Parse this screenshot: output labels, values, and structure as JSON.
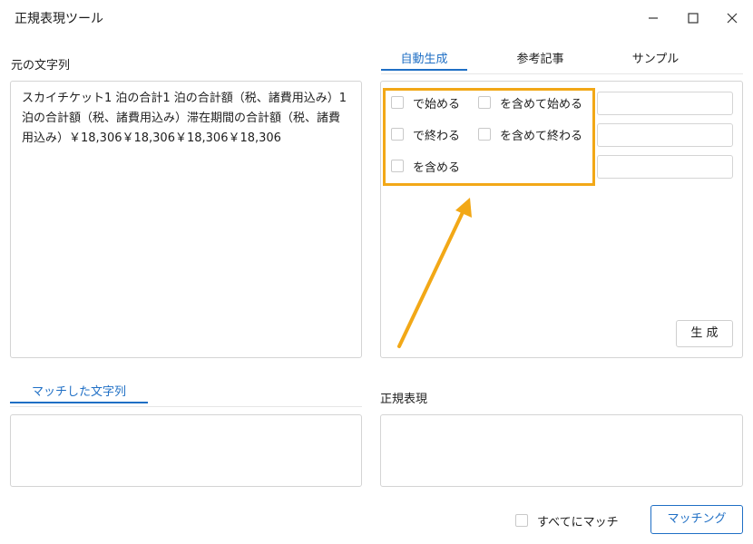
{
  "window": {
    "title": "正規表現ツール"
  },
  "source": {
    "label": "元の文字列",
    "text": "スカイチケット1 泊の合計1 泊の合計額（税、諸費用込み）1 泊の合計額（税、諸費用込み）滞在期間の合計額（税、諸費用込み）￥18,306￥18,306￥18,306￥18,306"
  },
  "tabs": [
    {
      "label": "自動生成"
    },
    {
      "label": "参考記事"
    },
    {
      "label": "サンプル"
    }
  ],
  "options": {
    "starts_with": "で始める",
    "contains_starts": "を含めて始める",
    "ends_with": "で終わる",
    "contains_ends": "を含めて終わる",
    "contains": "を含める"
  },
  "generate_button": "生 成",
  "matched": {
    "tab_label": "マッチした文字列"
  },
  "regex": {
    "label": "正規表現"
  },
  "footer": {
    "match_all_label": "すべてにマッチ",
    "matching_button": "マッチング"
  },
  "colors": {
    "accent": "#1f6fc5",
    "highlight": "#f2a817"
  }
}
